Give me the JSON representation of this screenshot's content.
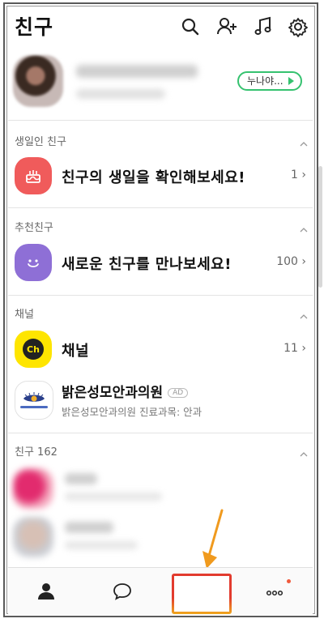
{
  "header": {
    "title": "친구"
  },
  "profile": {
    "status_message": "누나야..."
  },
  "sections": {
    "birthday": {
      "label": "생일인 친구",
      "row_text": "친구의 생일을 확인해보세요!",
      "count": "1"
    },
    "recommended": {
      "label": "추천친구",
      "row_text": "새로운 친구를 만나보세요!",
      "count": "100"
    },
    "channel": {
      "label": "채널",
      "row_text": "채널",
      "count": "11",
      "icon_text": "Ch",
      "ad": {
        "name": "밝은성모안과의원",
        "badge": "AD",
        "desc": "밝은성모안과의원 진료과목: 안과"
      }
    },
    "friends": {
      "label": "친구 162"
    }
  },
  "nav": {
    "hash_label": "#"
  },
  "colors": {
    "accent_green": "#35c26f",
    "birthday_red": "#f05b5b",
    "recommend_purple": "#8e6fd6",
    "channel_yellow": "#fee500",
    "highlight_red": "#e23b2e",
    "arrow_orange": "#f09a1e"
  },
  "icons": {
    "search": "search-icon",
    "add_friend": "add-friend-icon",
    "music": "music-note-icon",
    "settings": "gear-icon"
  }
}
